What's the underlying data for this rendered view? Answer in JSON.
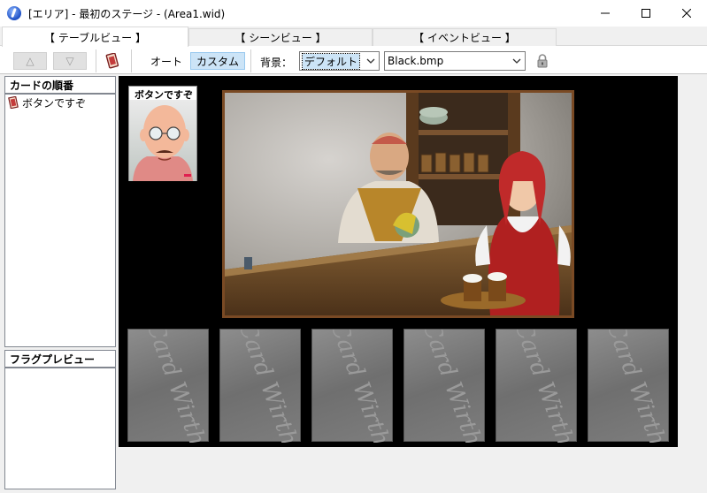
{
  "window": {
    "title": "[エリア] - 最初のステージ - (Area1.wid)"
  },
  "tabs": [
    {
      "label": "【 テーブルビュー 】",
      "active": true
    },
    {
      "label": "【 シーンビュー 】",
      "active": false
    },
    {
      "label": "【 イベントビュー 】",
      "active": false
    }
  ],
  "toolbar": {
    "up_label": "△",
    "down_label": "▽",
    "auto_label": "オート",
    "custom_label": "カスタム",
    "background_label": "背景：",
    "background_select": "デフォルト",
    "image_select": "Black.bmp"
  },
  "card_order_panel": {
    "title": "カードの順番",
    "items": [
      "ボタンですぞ"
    ]
  },
  "flag_preview_panel": {
    "title": "フラグプレビュー"
  },
  "stage": {
    "menu_card_title": "ボタンですぞ",
    "card_watermark": "Card Wirth"
  },
  "colors": {
    "accent_selected": "#cce4f7",
    "stage_background": "#000000",
    "scene_frame": "#7a4a24"
  }
}
